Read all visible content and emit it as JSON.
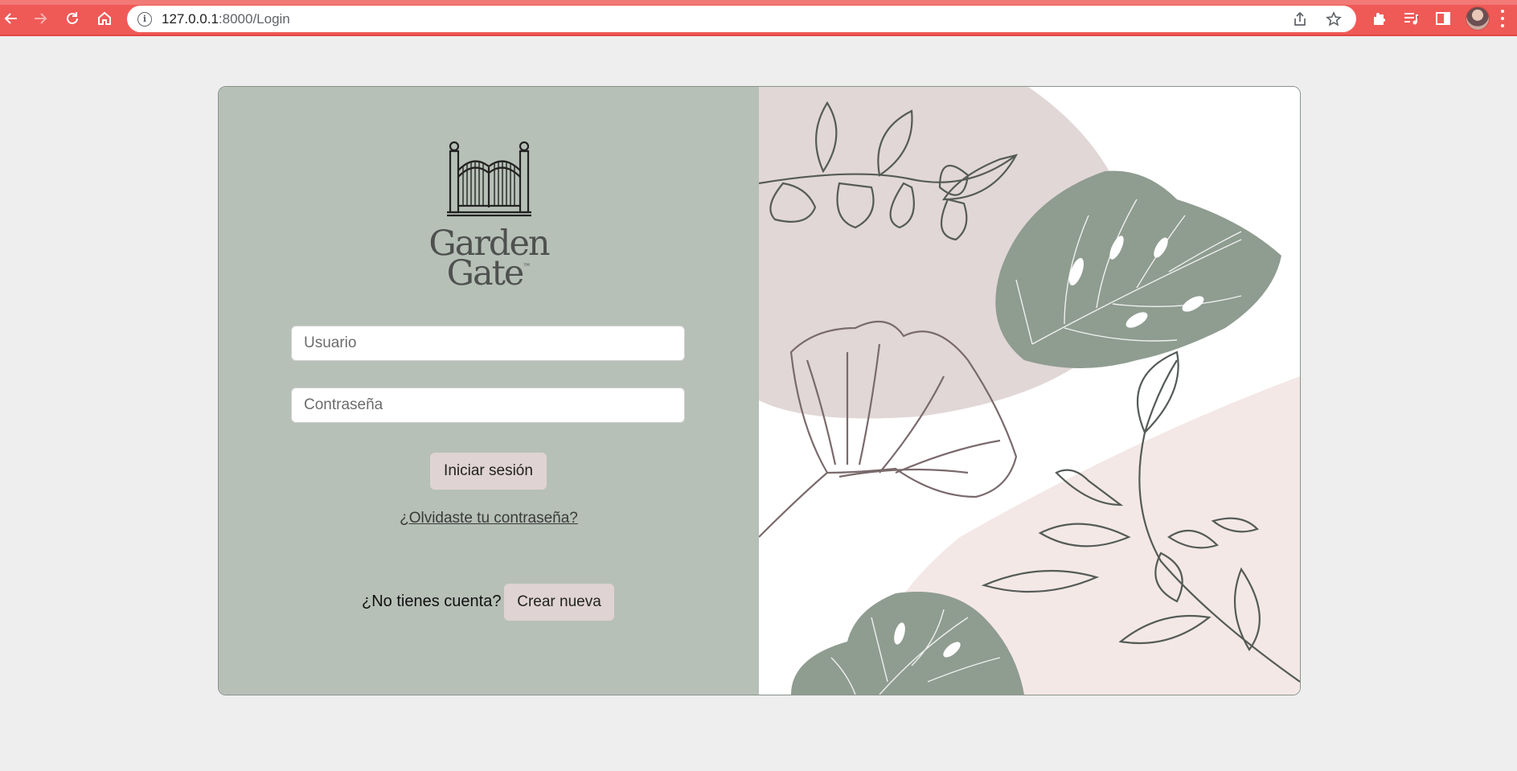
{
  "browser": {
    "url_host": "127.0.0.1",
    "url_path": ":8000/Login",
    "icons": [
      "back-icon",
      "forward-icon",
      "reload-icon",
      "home-icon",
      "site-info-icon",
      "share-icon",
      "bookmark-star-icon",
      "extensions-icon",
      "media-queue-icon",
      "side-panel-icon",
      "profile-avatar",
      "menu-icon"
    ]
  },
  "login": {
    "brand_line1": "Garden",
    "brand_line2": "Gate",
    "brand_tm": "™",
    "username_placeholder": "Usuario",
    "password_placeholder": "Contraseña",
    "login_button": "Iniciar sesión",
    "forgot_link": "¿Olvidaste tu contraseña?",
    "no_account_text": "¿No tienes cuenta?",
    "create_button": "Crear nueva"
  },
  "colors": {
    "chrome": "#ef5a57",
    "panel_left": "#b6c0b7",
    "button_bg": "#dfd3d3",
    "leaf_green": "#8f9c90",
    "blob_mauve": "#e1d7d7",
    "blob_pink": "#f3e8e6"
  }
}
